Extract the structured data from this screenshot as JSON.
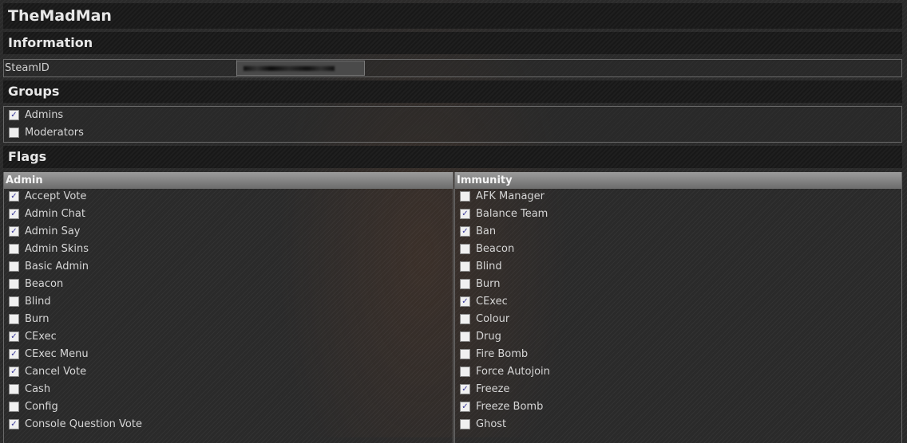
{
  "title": "TheMadMan",
  "information": {
    "heading": "Information",
    "steamid_label": "SteamID"
  },
  "groups": {
    "heading": "Groups",
    "items": [
      {
        "label": "Admins",
        "checked": true
      },
      {
        "label": "Moderators",
        "checked": false
      }
    ]
  },
  "flags": {
    "heading": "Flags",
    "admin": {
      "heading": "Admin",
      "items": [
        {
          "label": "Accept Vote",
          "checked": true
        },
        {
          "label": "Admin Chat",
          "checked": true
        },
        {
          "label": "Admin Say",
          "checked": true
        },
        {
          "label": "Admin Skins",
          "checked": false
        },
        {
          "label": "Basic Admin",
          "checked": false
        },
        {
          "label": "Beacon",
          "checked": false
        },
        {
          "label": "Blind",
          "checked": false
        },
        {
          "label": "Burn",
          "checked": false
        },
        {
          "label": "CExec",
          "checked": true
        },
        {
          "label": "CExec Menu",
          "checked": true
        },
        {
          "label": "Cancel Vote",
          "checked": true
        },
        {
          "label": "Cash",
          "checked": false
        },
        {
          "label": "Config",
          "checked": false
        },
        {
          "label": "Console Question Vote",
          "checked": true
        }
      ]
    },
    "immunity": {
      "heading": "Immunity",
      "items": [
        {
          "label": "AFK Manager",
          "checked": false
        },
        {
          "label": "Balance Team",
          "checked": true
        },
        {
          "label": "Ban",
          "checked": true
        },
        {
          "label": "Beacon",
          "checked": false
        },
        {
          "label": "Blind",
          "checked": false
        },
        {
          "label": "Burn",
          "checked": false
        },
        {
          "label": "CExec",
          "checked": true
        },
        {
          "label": "Colour",
          "checked": false
        },
        {
          "label": "Drug",
          "checked": false
        },
        {
          "label": "Fire Bomb",
          "checked": false
        },
        {
          "label": "Force Autojoin",
          "checked": false
        },
        {
          "label": "Freeze",
          "checked": true
        },
        {
          "label": "Freeze Bomb",
          "checked": true
        },
        {
          "label": "Ghost",
          "checked": false
        }
      ]
    }
  }
}
